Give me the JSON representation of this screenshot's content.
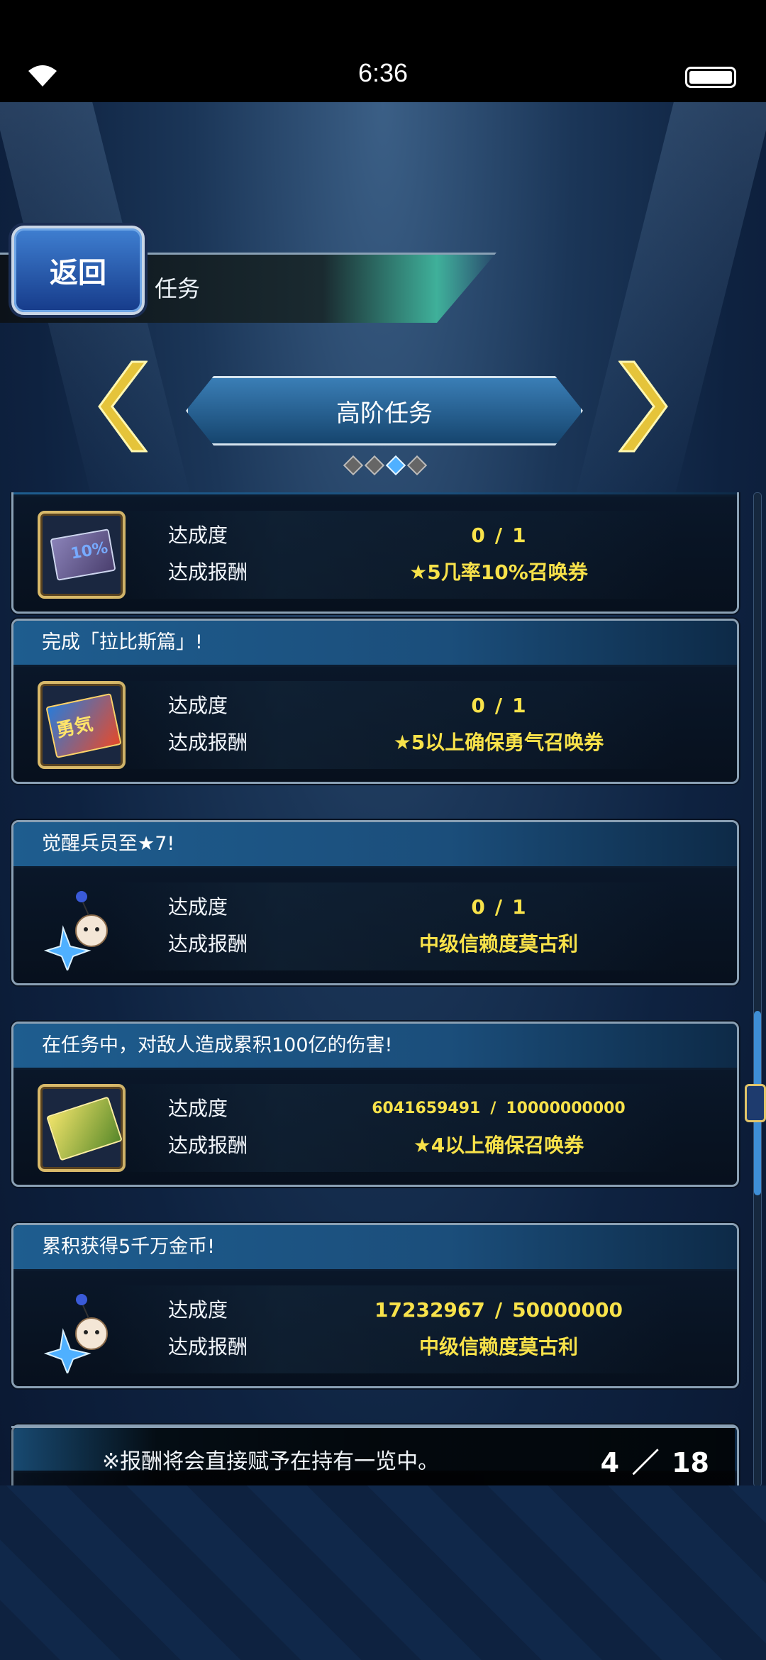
{
  "status_bar": {
    "time": "6:36"
  },
  "header": {
    "back_label": "返回",
    "title": "任务"
  },
  "category": {
    "label": "高阶任务",
    "pages": 4,
    "active_page": 3
  },
  "missions": [
    {
      "title": "",
      "progress_label": "达成度",
      "progress_current": "0",
      "progress_total": "1",
      "reward_label": "达成报酬",
      "reward": "★5几率10%召唤券",
      "icon": "ticket-10-percent-icon"
    },
    {
      "title": "完成「拉比斯篇」!",
      "progress_label": "达成度",
      "progress_current": "0",
      "progress_total": "1",
      "reward_label": "达成报酬",
      "reward": "★5以上确保勇气召唤券",
      "icon": "brave-ticket-icon"
    },
    {
      "title": "觉醒兵员至★7!",
      "progress_label": "达成度",
      "progress_current": "0",
      "progress_total": "1",
      "reward_label": "达成报酬",
      "reward": "中级信赖度莫古利",
      "icon": "moogle-icon"
    },
    {
      "title": "在任务中，对敌人造成累积100亿的伤害!",
      "progress_label": "达成度",
      "progress_current": "6041659491",
      "progress_total": "10000000000",
      "reward_label": "达成报酬",
      "reward": "★4以上确保召唤券",
      "icon": "summon-ticket-icon"
    },
    {
      "title": "累积获得5千万金币!",
      "progress_label": "达成度",
      "progress_current": "17232967",
      "progress_total": "50000000",
      "reward_label": "达成报酬",
      "reward": "中级信赖度莫古利",
      "icon": "moogle-icon"
    }
  ],
  "footer": {
    "note": "※报酬将会直接赋予在持有一览中。",
    "page_current": "4",
    "page_total": "18",
    "page_sep": "／"
  },
  "separator": "/"
}
